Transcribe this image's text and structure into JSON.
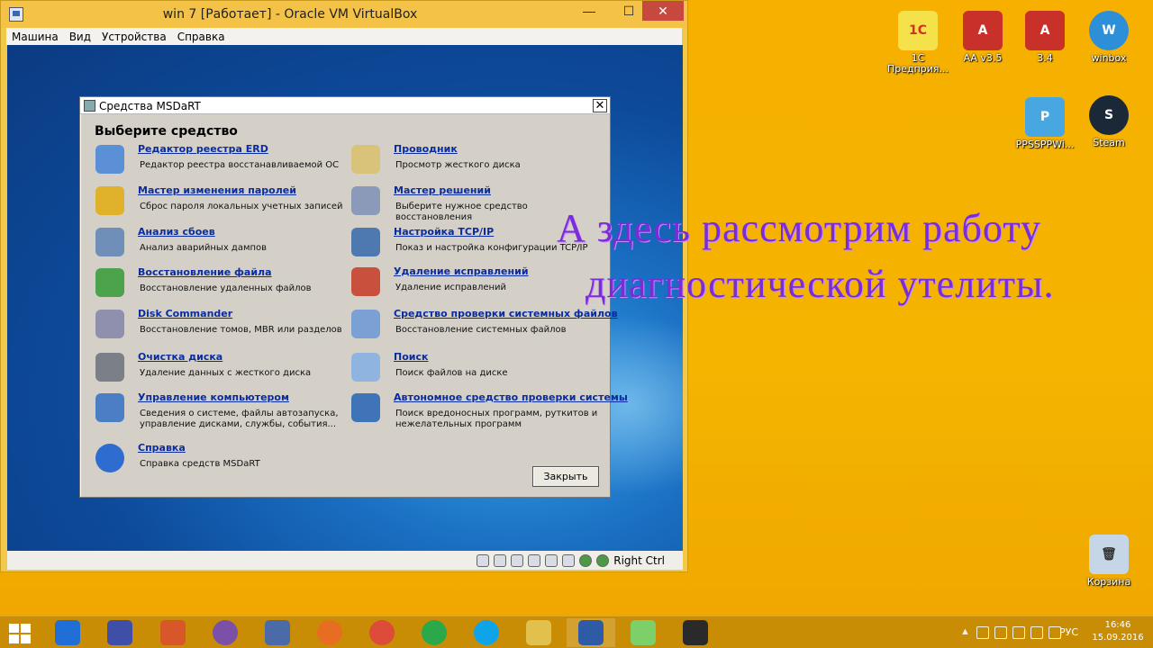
{
  "vbox": {
    "title": "win 7 [Работает] - Oracle VM VirtualBox",
    "min_glyph": "—",
    "max_glyph": "☐",
    "close_glyph": "✕",
    "menu": [
      "Машина",
      "Вид",
      "Устройства",
      "Справка"
    ],
    "status_host_key": "Right Ctrl"
  },
  "dialog": {
    "title": "Средства MSDaRT",
    "heading": "Выберите средство",
    "close_glyph": "✕",
    "close_button": "Закрыть",
    "tools": [
      {
        "name": "Редактор реестра ERD",
        "desc": "Редактор реестра восстанавливаемой ОС",
        "icon": "registry-icon",
        "color": "#5b8fd6"
      },
      {
        "name": "Проводник",
        "desc": "Просмотр жесткого диска",
        "icon": "explorer-icon",
        "color": "#d9c27a"
      },
      {
        "name": "Мастер изменения паролей",
        "desc": "Сброс пароля локальных учетных записей",
        "icon": "lock-icon",
        "color": "#e0b12a"
      },
      {
        "name": "Мастер решений",
        "desc": "Выберите нужное средство восстановления",
        "icon": "solution-wizard-icon",
        "color": "#8a9ab8"
      },
      {
        "name": "Анализ сбоев",
        "desc": "Анализ аварийных дампов",
        "icon": "crash-analyzer-icon",
        "color": "#6f8fb8"
      },
      {
        "name": "Настройка TCP/IP",
        "desc": "Показ и настройка конфигурации TCP/IP",
        "icon": "network-icon",
        "color": "#4d78b0"
      },
      {
        "name": "Восстановление файла",
        "desc": "Восстановление удаленных файлов",
        "icon": "file-restore-icon",
        "color": "#4ca34c"
      },
      {
        "name": "Удаление исправлений",
        "desc": "Удаление исправлений",
        "icon": "hotfix-uninstall-icon",
        "color": "#c9503c"
      },
      {
        "name": "Disk Commander",
        "desc": "Восстановление томов, MBR или разделов",
        "icon": "disk-commander-icon",
        "color": "#8f8fae"
      },
      {
        "name": "Средство проверки системных файлов",
        "desc": "Восстановление системных файлов",
        "icon": "sfc-icon",
        "color": "#7aa0d4"
      },
      {
        "name": "Очистка диска",
        "desc": "Удаление данных с жесткого диска",
        "icon": "disk-wipe-icon",
        "color": "#7a7f88"
      },
      {
        "name": "Поиск",
        "desc": "Поиск файлов на диске",
        "icon": "search-icon",
        "color": "#8fb4e0"
      },
      {
        "name": "Управление компьютером",
        "desc": "Сведения о системе, файлы автозапуска, управление дисками, службы, события...",
        "icon": "computer-management-icon",
        "color": "#4b7ec4"
      },
      {
        "name": "Автономное средство проверки системы",
        "desc": "Поиск вредоносных программ, руткитов и нежелательных программ",
        "icon": "standalone-sweeper-icon",
        "color": "#3f74b8"
      },
      {
        "name": "Справка",
        "desc": "Справка средств MSDaRT",
        "icon": "help-icon",
        "color": "#2f6ccf"
      }
    ]
  },
  "caption": {
    "line1": "А здесь рассмотрим работу",
    "line2": "диагностической утелиты."
  },
  "desktop_icons": [
    {
      "label": "1С Предприя...",
      "icon": "1c-icon",
      "color": "#f5e24a",
      "glyph": "1С"
    },
    {
      "label": "AA v3.5",
      "icon": "ammyy-admin-icon",
      "color": "#c8302a",
      "glyph": "A"
    },
    {
      "label": "3.4",
      "icon": "ammyy-admin-icon",
      "color": "#c8302a",
      "glyph": "A"
    },
    {
      "label": "winbox",
      "icon": "winbox-icon",
      "color": "#2d8fd8",
      "glyph": "W"
    },
    {
      "label": "PPSSPPWi...",
      "icon": "ppsspp-icon",
      "color": "#48a6e0",
      "glyph": "P"
    },
    {
      "label": "Steam",
      "icon": "steam-icon",
      "color": "#1b2838",
      "glyph": "S"
    },
    {
      "label": "Корзина",
      "icon": "recycle-bin-icon",
      "color": "#c5d7e6",
      "glyph": "🗑"
    }
  ],
  "taskbar": {
    "apps": [
      {
        "icon": "teamviewer-icon",
        "color": "#1f6fd6"
      },
      {
        "icon": "floppy-save-icon",
        "color": "#3f4fa8"
      },
      {
        "icon": "clipboard-tools-icon",
        "color": "#d8572a"
      },
      {
        "icon": "viber-icon",
        "color": "#7b51a8"
      },
      {
        "icon": "document-pen-icon",
        "color": "#4a6aa8"
      },
      {
        "icon": "firefox-icon",
        "color": "#e66d22"
      },
      {
        "icon": "chrome-icon",
        "color": "#dd4b39"
      },
      {
        "icon": "email-client-icon",
        "color": "#2aa84a"
      },
      {
        "icon": "skype-icon",
        "color": "#0fa3e8"
      },
      {
        "icon": "file-explorer-icon",
        "color": "#e2c04e"
      },
      {
        "icon": "virtualbox-icon",
        "color": "#2f5aa6"
      },
      {
        "icon": "notepad-icon",
        "color": "#7dcf6a"
      },
      {
        "icon": "remote-desktop-icon",
        "color": "#2a2a2a"
      }
    ],
    "lang": "РУС",
    "time": "16:46",
    "date": "15.09.2016"
  }
}
